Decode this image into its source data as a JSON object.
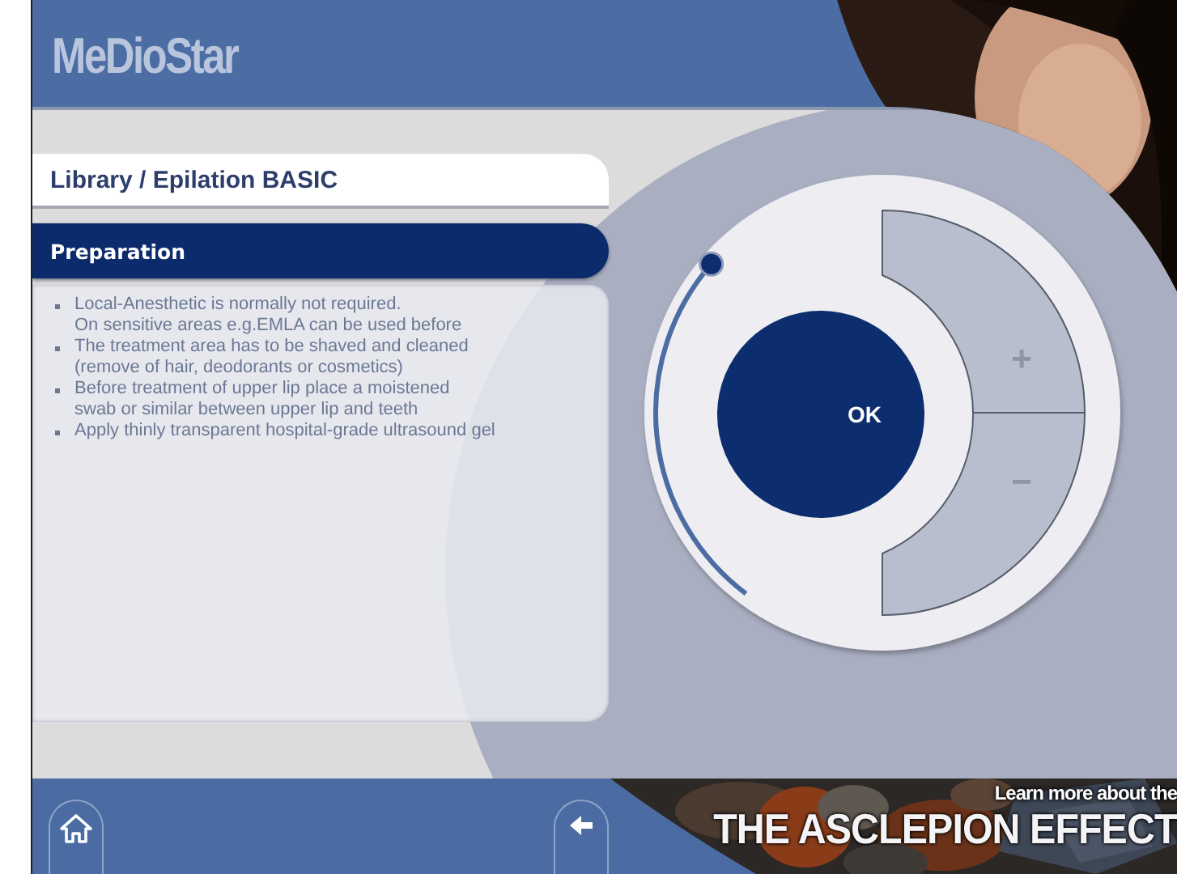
{
  "header": {
    "logo": "MeDioStar"
  },
  "breadcrumb": "Library / Epilation BASIC",
  "section": {
    "title": "Preparation",
    "items": [
      "Local-Anesthetic is normally not required.\nOn sensitive areas e.g.EMLA can be used before",
      "The treatment area has to be shaved and cleaned\n(remove of hair, deodorants or cosmetics)",
      "Before treatment of upper lip place a moistened\nswab or similar between upper lip and teeth",
      "Apply thinly transparent hospital-grade ultrasound gel"
    ]
  },
  "dial": {
    "ok": "OK",
    "plus": "+",
    "minus": "−",
    "level": 1
  },
  "footer": {
    "buttons": [
      {
        "kind": "home"
      },
      {
        "kind": "back"
      }
    ],
    "banner": {
      "tagline": "Learn more about the",
      "headline": "THE ASCLEPION EFFECT"
    }
  }
}
